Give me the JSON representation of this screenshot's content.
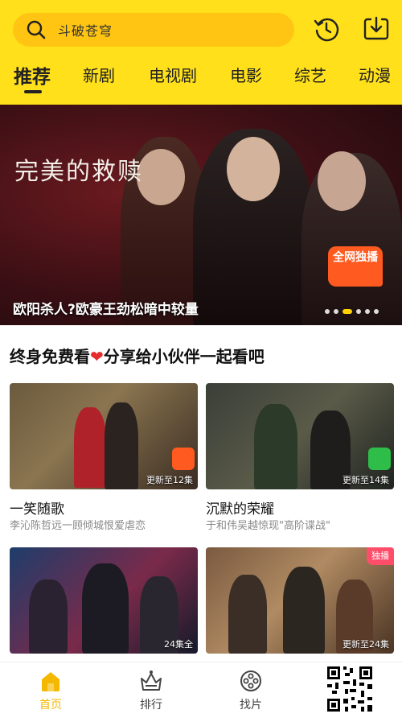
{
  "header": {
    "search_placeholder": "斗破苍穹",
    "icons": {
      "search": "search-icon",
      "history": "history-icon",
      "download": "download-icon"
    },
    "accent_color": "#FFE01B",
    "search_bg_color": "#FFC512"
  },
  "tabs": [
    {
      "label": "推荐",
      "active": true
    },
    {
      "label": "新剧",
      "active": false
    },
    {
      "label": "电视剧",
      "active": false
    },
    {
      "label": "电影",
      "active": false
    },
    {
      "label": "综艺",
      "active": false
    },
    {
      "label": "动漫",
      "active": false
    }
  ],
  "banner": {
    "show_title": "完美的救赎",
    "caption": "欧阳杀人?欧豪王劲松暗中较量",
    "badge": "全网独播",
    "slide_count": 6,
    "active_slide": 2
  },
  "section": {
    "title_before": "终身免费看",
    "heart": "❤",
    "title_after": "分享给小伙伴一起看吧"
  },
  "cards": [
    {
      "name": "一笑随歌",
      "desc": "李沁陈哲远一顾倾城恨爱虐恋",
      "episodes": "更新至12集"
    },
    {
      "name": "沉默的荣耀",
      "desc": "于和伟吴越惊现\"高阶谍战\"",
      "episodes": "更新至14集"
    },
    {
      "name": "",
      "desc": "",
      "episodes": "24集全"
    },
    {
      "name": "",
      "desc": "",
      "episodes": "更新至24集",
      "tag": "独播"
    }
  ],
  "bottom_nav": [
    {
      "label": "首页",
      "icon": "home-icon",
      "active": true
    },
    {
      "label": "排行",
      "icon": "ranking-crown-icon",
      "active": false
    },
    {
      "label": "找片",
      "icon": "film-reel-icon",
      "active": false
    }
  ],
  "active_color": "#F5B800"
}
